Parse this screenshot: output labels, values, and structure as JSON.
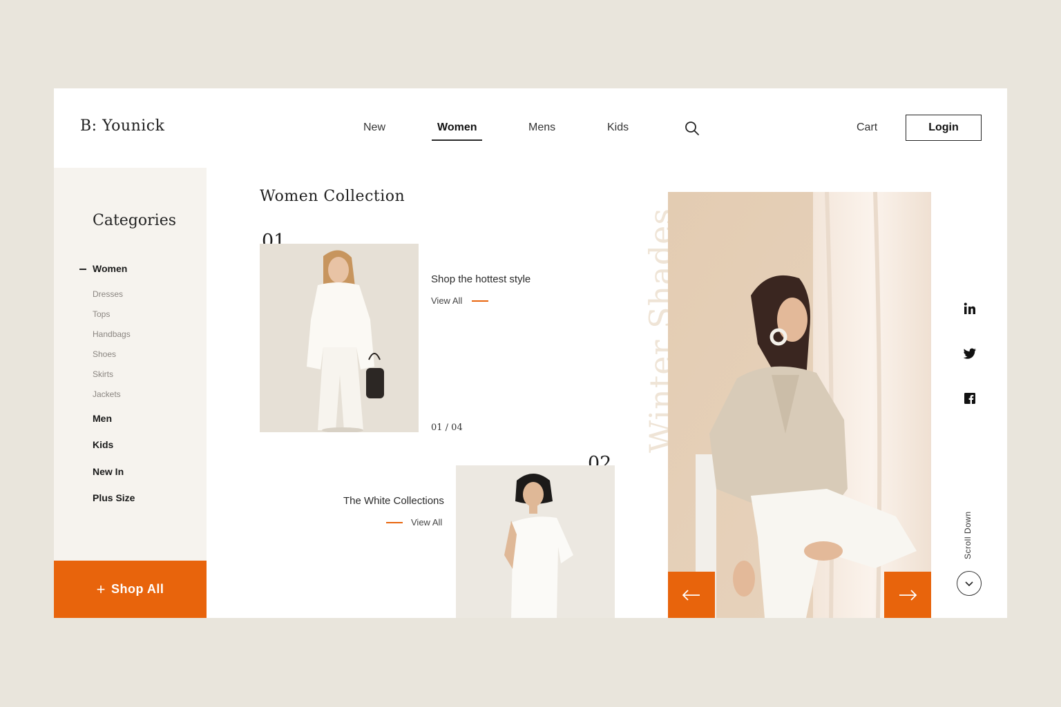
{
  "brand": {
    "logo": "B: Younick"
  },
  "nav": {
    "items": [
      {
        "label": "New",
        "active": false
      },
      {
        "label": "Women",
        "active": true
      },
      {
        "label": "Mens",
        "active": false
      },
      {
        "label": "Kids",
        "active": false
      }
    ],
    "cart_label": "Cart",
    "login_label": "Login"
  },
  "sidebar": {
    "title": "Categories",
    "active_category": "Women",
    "subcategories": [
      "Dresses",
      "Tops",
      "Handbags",
      "Shoes",
      "Skirts",
      "Jackets"
    ],
    "other_categories": [
      "Men",
      "Kids",
      "New In",
      "Plus Size"
    ],
    "shop_all_label": "Shop All"
  },
  "collection": {
    "title": "Women Collection",
    "items": [
      {
        "number": "01",
        "title": "Shop the hottest style",
        "link": "View All"
      },
      {
        "number": "02",
        "title": "The White Collections",
        "link": "View All"
      }
    ],
    "pager": "01 / 04"
  },
  "hero": {
    "vertical_text": "Winter Shades"
  },
  "social": [
    "linkedin-icon",
    "twitter-icon",
    "facebook-icon"
  ],
  "scroll_label": "Scroll Down",
  "colors": {
    "accent": "#e8640c",
    "background": "#e9e5dc",
    "sidebar": "#f6f3ee"
  }
}
